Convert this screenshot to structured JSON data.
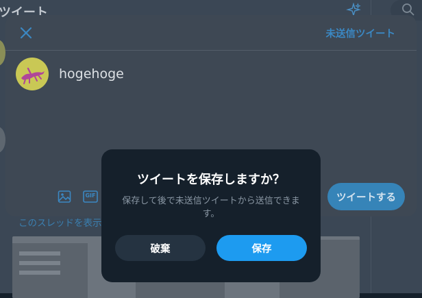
{
  "background": {
    "header_title": "ツイート",
    "thread_link": "このスレッドを表示"
  },
  "compose": {
    "drafts_label": "未送信ツイート",
    "text": "hogehoge",
    "tweet_button": "ツイートする",
    "gif_label": "GIF",
    "icons": [
      "close-icon",
      "image-icon",
      "gif-icon",
      "sparkle-icon",
      "search-icon"
    ]
  },
  "dialog": {
    "title": "ツイートを保存しますか？",
    "body": "保存して後で未送信ツイートから送信できます。",
    "discard_label": "破棄",
    "save_label": "保存"
  },
  "colors": {
    "accent": "#1d9bf0",
    "dialog_bg": "#15202b",
    "discard_bg": "#253341",
    "compose_bg": "#3e4854"
  }
}
